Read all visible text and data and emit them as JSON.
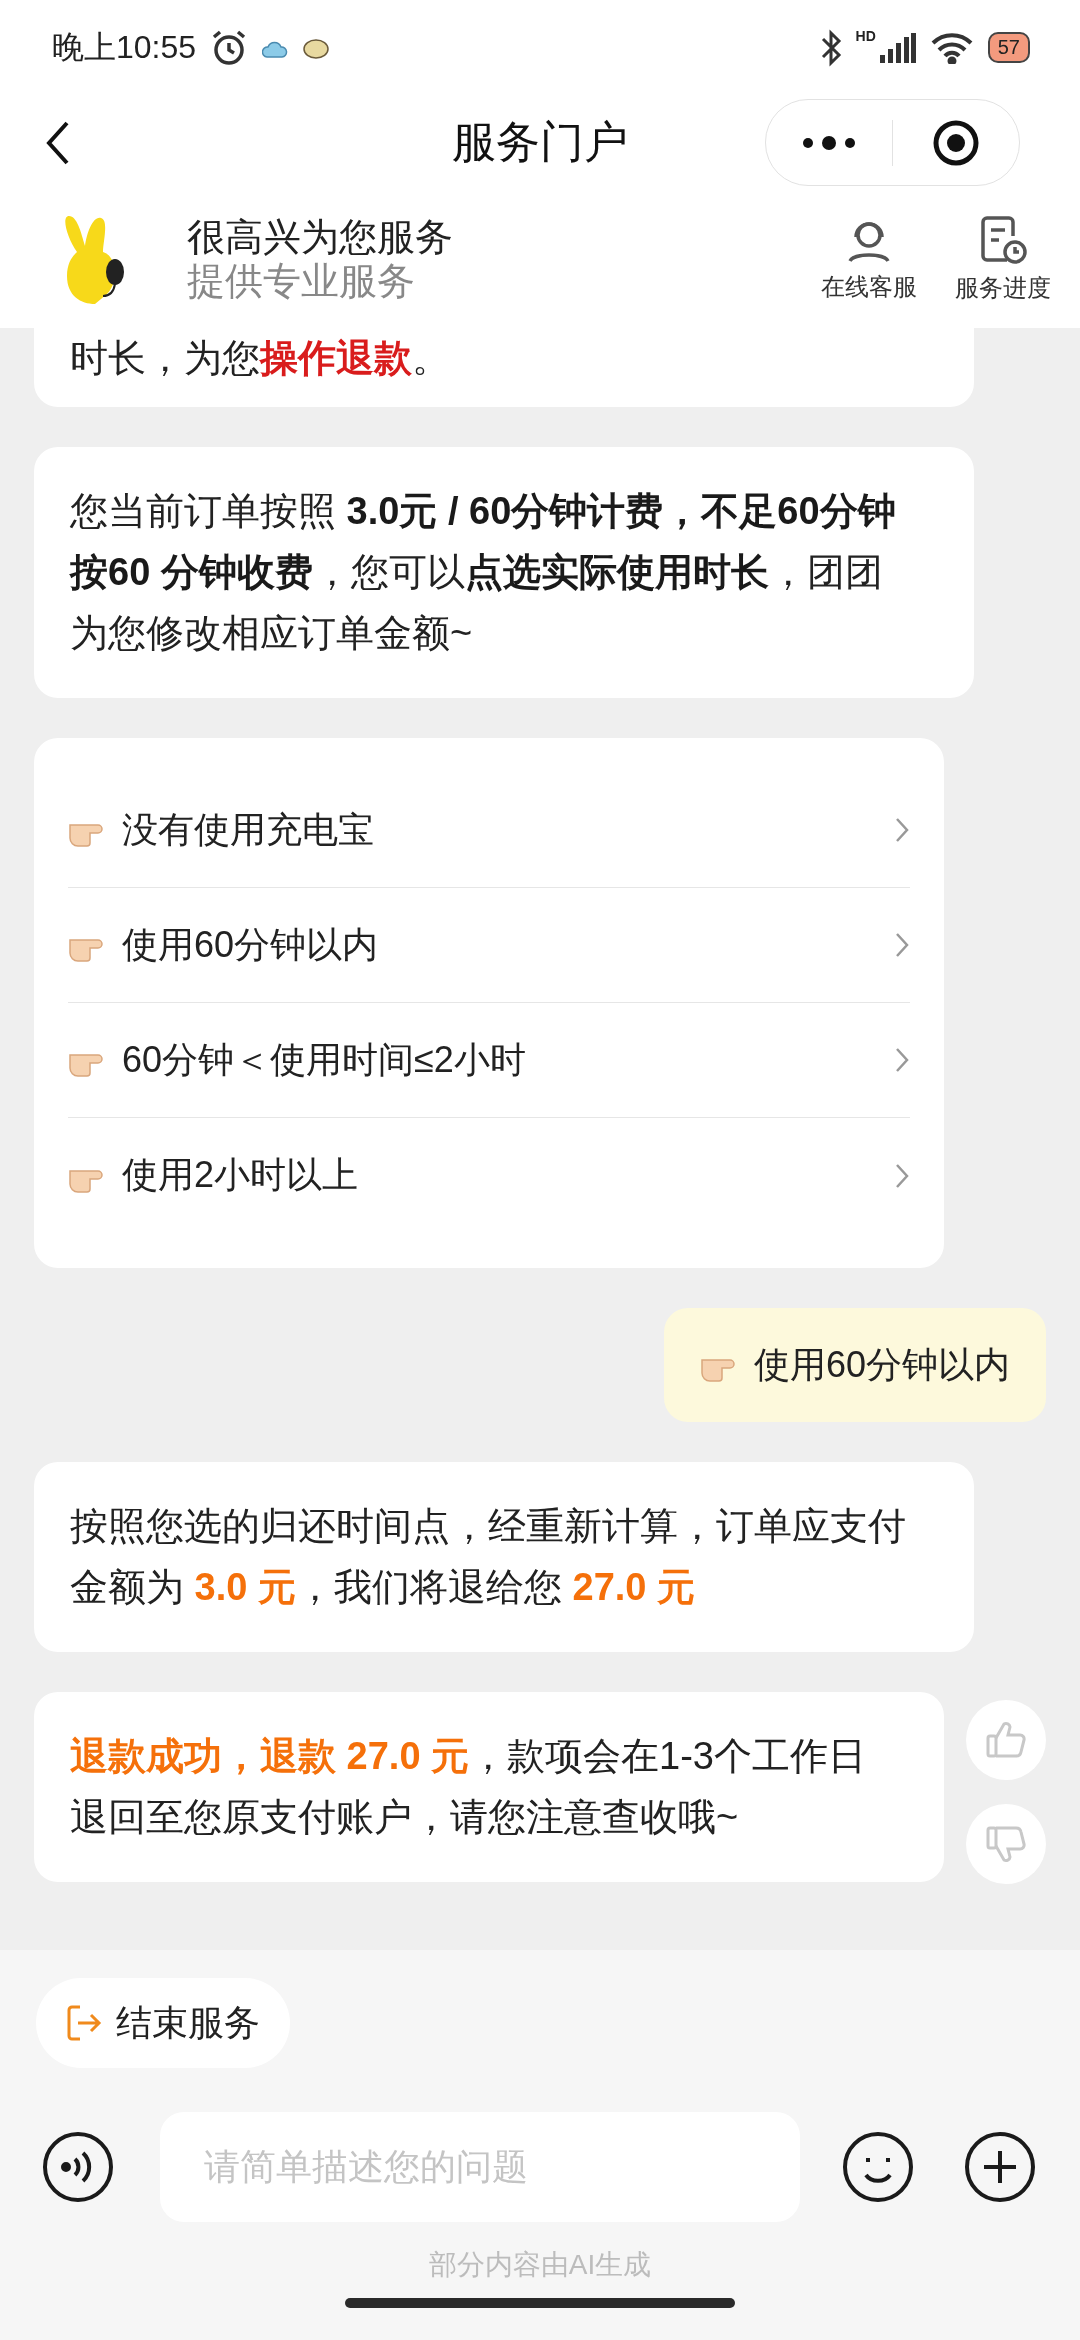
{
  "status_bar": {
    "time": "晚上10:55",
    "signal_label": "HD",
    "battery": "57"
  },
  "nav": {
    "title": "服务门户"
  },
  "agent": {
    "greeting": "很高兴为您服务",
    "subtitle": "提供专业服务",
    "actions": [
      {
        "kind": "headset",
        "label": "在线客服"
      },
      {
        "kind": "progress",
        "label": "服务进度"
      }
    ]
  },
  "messages": [
    {
      "kind": "bot",
      "text": "时长，为您**操作退款**。",
      "color": "#d91c1c",
      "feedback": false
    },
    {
      "kind": "bot",
      "text": "您当前订单按照 **3.0元 / 60分钟计费，不足60分钟按60 分钟收费**，您可以**点选实际使用时长**，团团为您修改相应订单金额~",
      "color": "#1a1a1a",
      "feedback": false
    },
    {
      "kind": "options",
      "items": [
        "没有使用充电宝",
        "使用60分钟以内",
        "60分钟＜使用时间≤2小时",
        "使用2小时以上"
      ]
    },
    {
      "kind": "user",
      "text": "使用60分钟以内"
    },
    {
      "kind": "bot",
      "text": "按照您选的归还时间点，经重新计算，订单应支付金额为 **3.0 元**，我们将退给您 **27.0 元**",
      "color": "#f5700a",
      "feedback": false
    },
    {
      "kind": "bot",
      "text": "**退款成功，退款 27.0 元**，款项会在1-3个工作日退回至您原支付账户，请您注意查收哦~",
      "color": "#f5700a",
      "feedback": true
    }
  ],
  "end_button": "结束服务",
  "input": {
    "placeholder": "请简单描述您的问题"
  },
  "footer_note": "部分内容由AI生成"
}
